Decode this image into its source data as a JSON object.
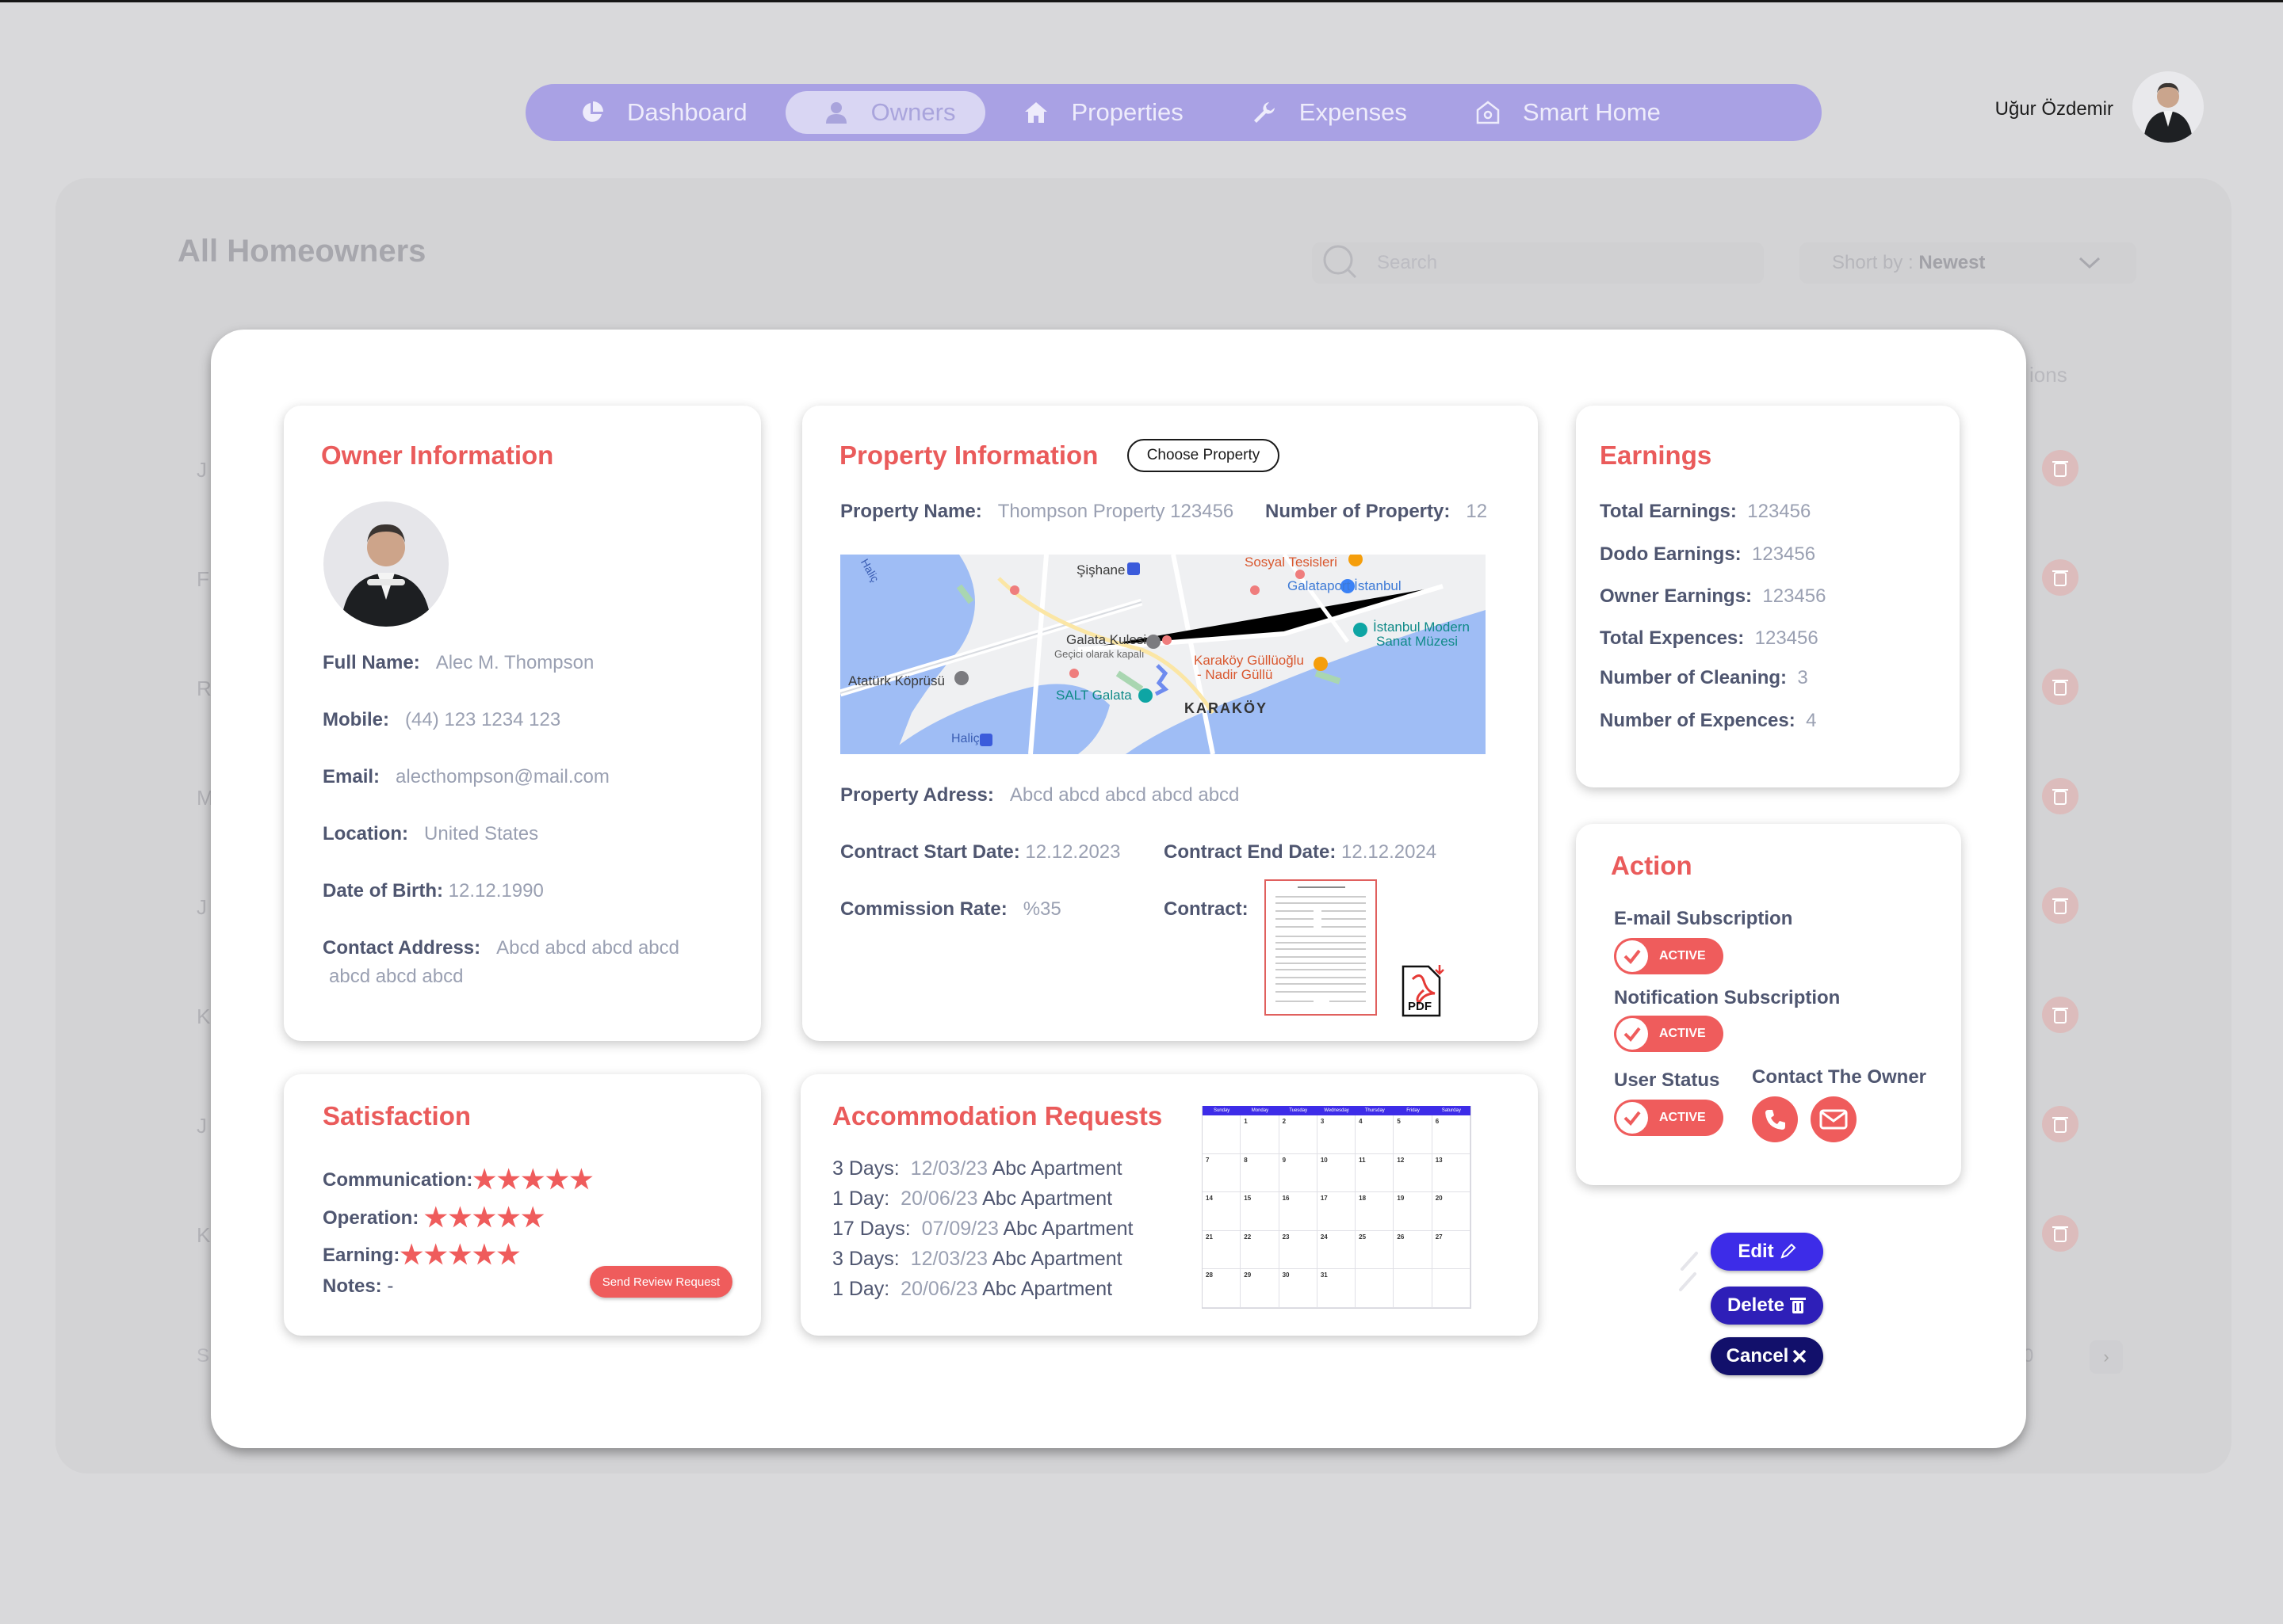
{
  "nav": {
    "items": [
      {
        "label": "Dashboard",
        "icon": "pie-chart-icon"
      },
      {
        "label": "Owners",
        "icon": "user-icon",
        "active": true
      },
      {
        "label": "Properties",
        "icon": "home-icon"
      },
      {
        "label": "Expenses",
        "icon": "wrench-icon"
      },
      {
        "label": "Smart Home",
        "icon": "smart-home-icon"
      }
    ]
  },
  "user": {
    "name": "Uğur Özdemir"
  },
  "page": {
    "title": "All Homeowners",
    "search_placeholder": "Search",
    "sort_prefix": "Short by : ",
    "sort_value": "Newest"
  },
  "owner": {
    "title": "Owner Information",
    "full_name_label": "Full Name:",
    "full_name": "Alec M. Thompson",
    "mobile_label": "Mobile:",
    "mobile": "(44) 123 1234 123",
    "email_label": "Email:",
    "email": "alecthompson@mail.com",
    "location_label": "Location:",
    "location": "United States",
    "dob_label": "Date of Birth:",
    "dob": "12.12.1990",
    "address_label": "Contact Address:",
    "address_line1": "Abcd abcd abcd abcd",
    "address_line2": "abcd abcd abcd"
  },
  "property": {
    "title": "Property  Information",
    "choose_button": "Choose Property",
    "name_label": "Property Name:",
    "name": "Thompson Property 123456",
    "number_label": "Number of Property:",
    "number": "12",
    "address_label": "Property Adress:",
    "address": "Abcd abcd abcd abcd abcd",
    "start_label": "Contract Start Date:",
    "start": "12.12.2023",
    "end_label": "Contract End Date:",
    "end": "12.12.2024",
    "commission_label": "Commission Rate:",
    "commission": "%35",
    "contract_label": "Contract:",
    "pdf_label": "PDF",
    "map_labels": {
      "sishane": "Şişhane",
      "sosyal": "Sosyal Tesisleri",
      "galataport": "Galataport İstanbul",
      "galata": "Galata Kulesi",
      "galata_sub": "Geçici olarak kapalı",
      "ataturk": "Atatürk Köprüsü",
      "karakoy_gulluoglu": "Karaköy Güllüoğlu",
      "nadir": "- Nadir Güllü",
      "modern": "İstanbul Modern",
      "sanat": "Sanat Müzesi",
      "salt": "SALT Galata",
      "karakoy": "KARAKÖY",
      "halic": "Haliç",
      "halic_top": "Haliç"
    }
  },
  "earnings": {
    "title": "Earnings",
    "rows": [
      {
        "label": "Total Earnings:",
        "value": "123456"
      },
      {
        "label": "Dodo Earnings:",
        "value": "123456"
      },
      {
        "label": "Owner Earnings:",
        "value": "123456"
      },
      {
        "label": "Total Expences:",
        "value": "123456"
      },
      {
        "label": "Number of Cleaning:",
        "value": "3"
      },
      {
        "label": "Number of Expences:",
        "value": "4"
      }
    ]
  },
  "action": {
    "title": "Action",
    "email_sub": "E-mail Subscription",
    "notif_sub": "Notification Subscription",
    "user_status": "User Status",
    "contact_owner": "Contact The Owner",
    "active": "ACTIVE"
  },
  "satisfaction": {
    "title": "Satisfaction",
    "communication_label": "Communication:",
    "communication": 5,
    "operation_label": "Operation:",
    "operation": 5,
    "earning_label": "Earning:",
    "earning": 5,
    "stars_text": "★★★★★",
    "notes_label": "Notes:",
    "notes": "-",
    "review_button": "Send Review Request"
  },
  "accommodation": {
    "title": "Accommodation Requests",
    "rows": [
      {
        "duration": "3 Days:",
        "date": "12/03/23",
        "place": "Abc Apartment"
      },
      {
        "duration": "1 Day:",
        "date": "20/06/23",
        "place": "Abc Apartment"
      },
      {
        "duration": "17 Days:",
        "date": "07/09/23",
        "place": "Abc Apartment"
      },
      {
        "duration": "3 Days:",
        "date": "12/03/23",
        "place": "Abc Apartment"
      },
      {
        "duration": "1 Day:",
        "date": "20/06/23",
        "place": "Abc Apartment"
      }
    ],
    "calendar": {
      "days": [
        "Sunday",
        "Monday",
        "Tuesday",
        "Wednesday",
        "Thursday",
        "Friday",
        "Saturday"
      ],
      "cells": [
        "",
        "1",
        "2",
        "3",
        "4",
        "5",
        "6",
        "7",
        "8",
        "9",
        "10",
        "11",
        "12",
        "13",
        "14",
        "15",
        "16",
        "17",
        "18",
        "19",
        "20",
        "21",
        "22",
        "23",
        "24",
        "25",
        "26",
        "27",
        "28",
        "29",
        "30",
        "31",
        "",
        "",
        ""
      ]
    }
  },
  "buttons": {
    "edit": "Edit",
    "delete": "Delete",
    "cancel": "Cancel"
  },
  "background_rows": {
    "letters": [
      "J",
      "F",
      "R",
      "M",
      "J",
      "K",
      "J",
      "K"
    ],
    "ions": "ions",
    "s": "S",
    "zero": "0"
  },
  "colors": {
    "accent": "#EF5C5C",
    "nav": "#A9A1E4",
    "edit": "#3D2CE8",
    "delete": "#2E1FB8",
    "cancel": "#12106B"
  }
}
